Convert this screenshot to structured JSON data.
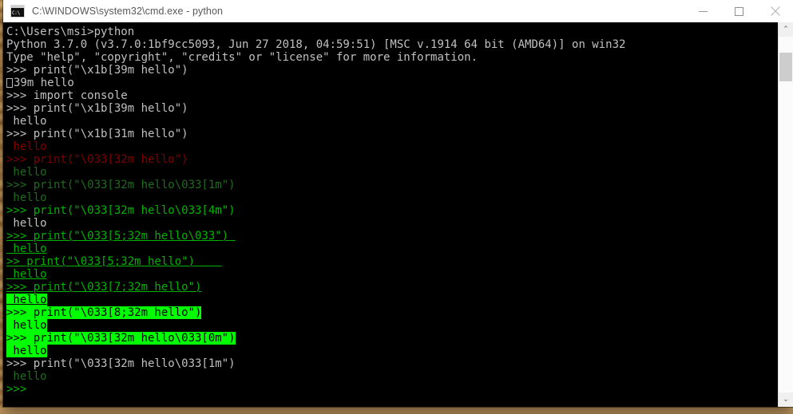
{
  "window": {
    "title": "C:\\WINDOWS\\system32\\cmd.exe - python",
    "icon": "cmd-icon",
    "icon_glyph": "C:\\",
    "buttons": {
      "minimize": "minimize-button",
      "maximize": "maximize-button",
      "close": "close-button"
    }
  },
  "scrollbar": {
    "up_arrow": "⌃",
    "down_arrow": "⌄"
  },
  "colors": {
    "background": "#000000",
    "default_text": "#c0c0c0",
    "dim_red": "#800000",
    "dim_green": "#1f6b1f",
    "green": "#00b300",
    "bright_green": "#00ff00",
    "titlebar": "#ffffff",
    "title_text": "#585858",
    "scrollbar_track": "#fbfbfb",
    "scrollbar_thumb": "#cdcdcd",
    "desktop": "#c89a5b"
  },
  "console": {
    "lines": [
      {
        "text": "C:\\Users\\msi>python",
        "style": "c-white"
      },
      {
        "text": "Python 3.7.0 (v3.7.0:1bf9cc5093, Jun 27 2018, 04:59:51) [MSC v.1914 64 bit (AMD64)] on win32",
        "style": "c-white"
      },
      {
        "text": "Type \"help\", \"copyright\", \"credits\" or \"license\" for more information.",
        "style": "c-white"
      },
      {
        "text": ">>> print(\"\\x1b[39m hello\")",
        "style": "c-white"
      },
      {
        "text": "39m hello",
        "style": "c-white",
        "esc_box": true
      },
      {
        "text": ">>> import console",
        "style": "c-white"
      },
      {
        "text": ">>> print(\"\\x1b[39m hello\")",
        "style": "c-white"
      },
      {
        "text": " hello",
        "style": "c-white"
      },
      {
        "text": ">>> print(\"\\x1b[31m hello\")",
        "style": "c-white"
      },
      {
        "text": " hello",
        "style": "c-dred"
      },
      {
        "text": ">>> print(\"\\033[32m hello\")",
        "style": "c-dred"
      },
      {
        "text": " hello",
        "style": "c-dgreen"
      },
      {
        "text": ">>> print(\"\\033[32m hello\\033[1m\")",
        "style": "c-dgreen"
      },
      {
        "text": " hello",
        "style": "c-dgreen"
      },
      {
        "text": ">>> print(\"\\033[32m hello\\033[4m\")",
        "style": "c-green"
      },
      {
        "text": " hello",
        "style": "c-white"
      },
      {
        "text": ">>> print(\"\\033[5;32m hello\\033\") ",
        "style": "c-green c-ul"
      },
      {
        "text": " hello",
        "style": "c-green c-ul"
      },
      {
        "text": ">> print(\"\\033[5;32m hello\")    ",
        "style": "c-green c-ul"
      },
      {
        "text": " hello",
        "style": "c-green c-ul"
      },
      {
        "text": ">>> print(\"\\033[7;32m hello\")",
        "style": "c-green c-ul"
      },
      {
        "text": " hello",
        "style": "c-revb c-ul"
      },
      {
        "text": ">>> print(\"\\033[8;32m hello\")",
        "style": "c-revb"
      },
      {
        "text": " hello",
        "style": "c-revb"
      },
      {
        "text": ">>> print(\"\\033[32m hello\\033[0m\")",
        "style": "c-revb"
      },
      {
        "text": " hello",
        "style": "c-revb"
      },
      {
        "text": ">>> print(\"\\033[32m hello\\033[1m\")",
        "style": "c-white"
      },
      {
        "text": " hello",
        "style": "c-dgreen"
      },
      {
        "text": ">>>",
        "style": "c-green"
      }
    ]
  }
}
